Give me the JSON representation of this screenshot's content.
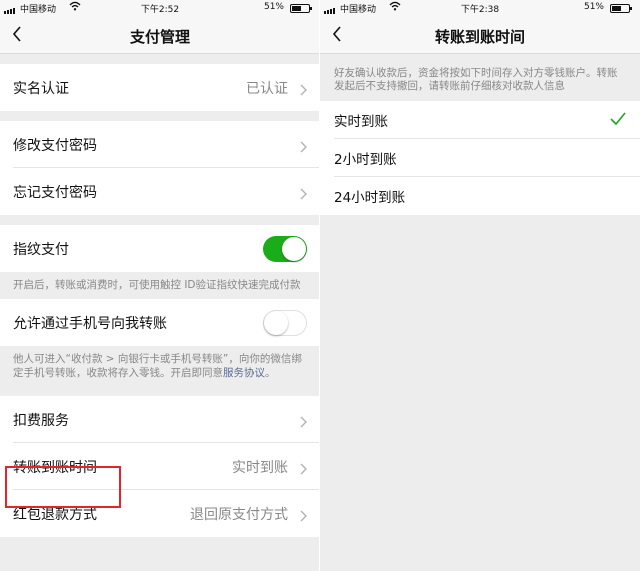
{
  "left": {
    "status": {
      "carrier": "中国移动",
      "time": "下午2:52",
      "battery": "51%",
      "battery_level": 0.51
    },
    "nav": {
      "title": "支付管理"
    },
    "rows": {
      "realname": {
        "label": "实名认证",
        "value": "已认证"
      },
      "change_pwd": {
        "label": "修改支付密码"
      },
      "forgot_pwd": {
        "label": "忘记支付密码"
      },
      "fingerprint": {
        "label": "指纹支付",
        "enabled": true
      },
      "fingerprint_note": "开启后，转账或消费时，可使用触控 ID验证指纹快速完成付款",
      "phone_transfer": {
        "label": "允许通过手机号向我转账",
        "enabled": false
      },
      "phone_note_pre": "他人可进入“收付款 > 向银行卡或手机号转账”，向你的微信绑定手机号转账，收款将存入零钱。开启即同意",
      "phone_note_link": "服务协议",
      "phone_note_post": "。",
      "deduction": {
        "label": "扣费服务"
      },
      "transfer_time": {
        "label": "转账到账时间",
        "value": "实时到账"
      },
      "refund": {
        "label": "红包退款方式",
        "value": "退回原支付方式"
      }
    }
  },
  "right": {
    "status": {
      "carrier": "中国移动",
      "time": "下午2:38",
      "battery": "51%",
      "battery_level": 0.51
    },
    "nav": {
      "title": "转账到账时间"
    },
    "description": "好友确认收款后，资金将按如下时间存入对方零钱账户。转账发起后不支持撤回，请转账前仔细核对收款人信息",
    "options": [
      {
        "label": "实时到账",
        "selected": true
      },
      {
        "label": "2小时到账",
        "selected": false
      },
      {
        "label": "24小时到账",
        "selected": false
      }
    ]
  },
  "colors": {
    "accent": "#1aad19",
    "highlight": "#e0262c",
    "link": "#576b95"
  }
}
